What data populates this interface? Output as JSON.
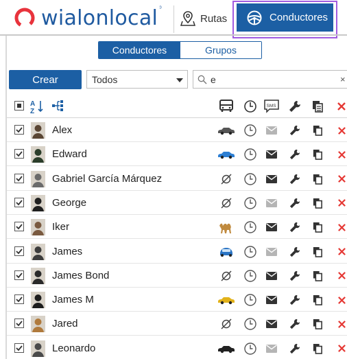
{
  "header": {
    "logo_word1": "wialon",
    "logo_word2": "local",
    "nav": [
      {
        "label": "Rutas",
        "icon": "map-pin-icon"
      },
      {
        "label": "Conductores",
        "icon": "steering-wheel-icon",
        "active": true
      }
    ]
  },
  "tabs": {
    "drivers_label": "Conductores",
    "groups_label": "Grupos"
  },
  "toolbar": {
    "create_label": "Crear",
    "filter_value": "Todos",
    "search_value": "e",
    "clear_label": "×"
  },
  "table_header": {
    "icons": [
      "sort-az-icon",
      "group-tree-icon",
      "vehicle-icon",
      "clock-icon",
      "sms-icon",
      "wrench-icon",
      "copy-icon",
      "delete-icon"
    ]
  },
  "drivers": [
    {
      "name": "Alex",
      "unit": "car-dark",
      "msg_active": false,
      "avatar": "#5a4634"
    },
    {
      "name": "Edward",
      "unit": "car-blue",
      "msg_active": true,
      "avatar": "#2b3d2a"
    },
    {
      "name": "Gabriel García Márquez",
      "unit": "none",
      "msg_active": true,
      "avatar": "#6b6b6b"
    },
    {
      "name": "George",
      "unit": "none",
      "msg_active": false,
      "avatar": "#1f1f1f"
    },
    {
      "name": "Iker",
      "unit": "camel",
      "msg_active": true,
      "avatar": "#7a5a40"
    },
    {
      "name": "James",
      "unit": "car-blue-front",
      "msg_active": false,
      "avatar": "#3c3c3c"
    },
    {
      "name": "James Bond",
      "unit": "none",
      "msg_active": true,
      "avatar": "#2a2a2a"
    },
    {
      "name": "James M",
      "unit": "car-yellow",
      "msg_active": true,
      "avatar": "#1d1d1d"
    },
    {
      "name": "Jared",
      "unit": "none",
      "msg_active": true,
      "avatar": "#b07a3c"
    },
    {
      "name": "Leonardo",
      "unit": "car-black",
      "msg_active": false,
      "avatar": "#4a4a4a"
    }
  ],
  "colors": {
    "accent": "#1c5fa4",
    "highlight_frame": "#a15ce0",
    "delete": "#e53935",
    "icon_dark": "#333333",
    "icon_muted": "#b5b5b5"
  }
}
